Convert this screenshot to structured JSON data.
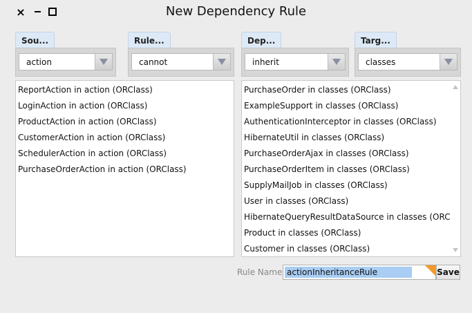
{
  "window": {
    "title": "New Dependency Rule"
  },
  "selectors": {
    "source": {
      "tab": "Sou...",
      "value": "action"
    },
    "rule": {
      "tab": "Rule...",
      "value": "cannot"
    },
    "dep": {
      "tab": "Dep...",
      "value": "inherit"
    },
    "target": {
      "tab": "Targ...",
      "value": "classes"
    }
  },
  "source_list": [
    "ReportAction in action (ORClass)",
    "LoginAction in action (ORClass)",
    "ProductAction in action (ORClass)",
    "CustomerAction in action (ORClass)",
    "SchedulerAction in action (ORClass)",
    "PurchaseOrderAction in action (ORClass)"
  ],
  "target_list": [
    "PurchaseOrder in classes (ORClass)",
    "ExampleSupport in classes (ORClass)",
    "AuthenticationInterceptor in classes (ORClass)",
    "HibernateUtil in classes (ORClass)",
    "PurchaseOrderAjax in classes (ORClass)",
    "PurchaseOrderItem in classes (ORClass)",
    "SupplyMailJob in classes (ORClass)",
    "User in classes (ORClass)",
    "HibernateQueryResultDataSource in classes (ORClass)",
    "Product in classes (ORClass)",
    "Customer in classes (ORClass)"
  ],
  "rule_name": {
    "label": "Rule Name:",
    "value": "actionInheritanceRule"
  },
  "save_label": "Save",
  "colors": {
    "tab_bg": "#dde9f6",
    "selection": "#a9cdf3",
    "corner_accent": "#f29a2b"
  }
}
